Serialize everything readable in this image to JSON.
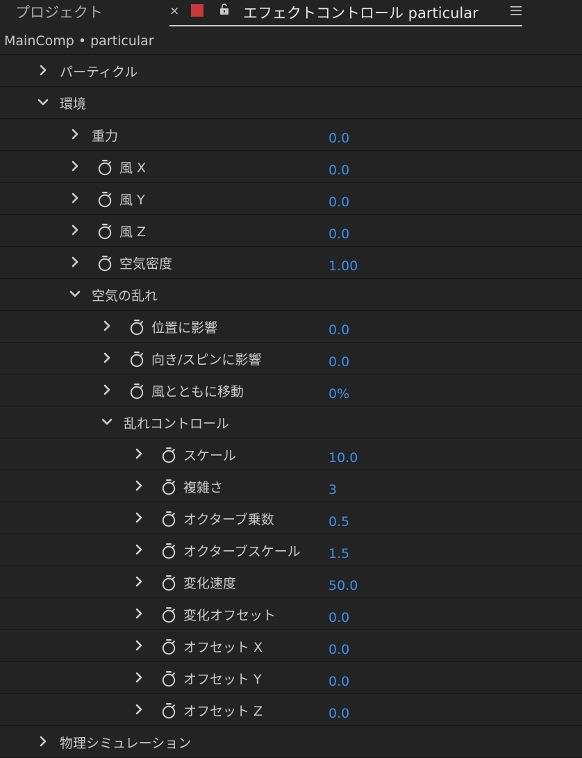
{
  "tabs": {
    "project_label": "プロジェクト",
    "close_glyph": "×",
    "active_label": "エフェクトコントロール particular",
    "accent_color": "#c8373a"
  },
  "breadcrumb": "MainComp • particular",
  "value_color": "#3d8fe8",
  "rows": [
    {
      "label": "パーティクル",
      "value": "",
      "expanded": false,
      "stopwatch": false,
      "depth": 0
    },
    {
      "label": "環境",
      "value": "",
      "expanded": true,
      "stopwatch": false,
      "depth": 0
    },
    {
      "label": "重力",
      "value": "0.0",
      "expanded": false,
      "stopwatch": false,
      "depth": 1
    },
    {
      "label": "風 X",
      "value": "0.0",
      "expanded": false,
      "stopwatch": true,
      "depth": 1
    },
    {
      "label": "風 Y",
      "value": "0.0",
      "expanded": false,
      "stopwatch": true,
      "depth": 1
    },
    {
      "label": "風 Z",
      "value": "0.0",
      "expanded": false,
      "stopwatch": true,
      "depth": 1
    },
    {
      "label": "空気密度",
      "value": "1.00",
      "expanded": false,
      "stopwatch": true,
      "depth": 1
    },
    {
      "label": "空気の乱れ",
      "value": "",
      "expanded": true,
      "stopwatch": false,
      "depth": 1
    },
    {
      "label": "位置に影響",
      "value": "0.0",
      "expanded": false,
      "stopwatch": true,
      "depth": 2
    },
    {
      "label": "向き/スピンに影響",
      "value": "0.0",
      "expanded": false,
      "stopwatch": true,
      "depth": 2
    },
    {
      "label": "風とともに移動",
      "value": "0%",
      "expanded": false,
      "stopwatch": true,
      "depth": 2
    },
    {
      "label": "乱れコントロール",
      "value": "",
      "expanded": true,
      "stopwatch": false,
      "depth": 2
    },
    {
      "label": "スケール",
      "value": "10.0",
      "expanded": false,
      "stopwatch": true,
      "depth": 3
    },
    {
      "label": "複雑さ",
      "value": "3",
      "expanded": false,
      "stopwatch": true,
      "depth": 3
    },
    {
      "label": "オクターブ乗数",
      "value": "0.5",
      "expanded": false,
      "stopwatch": true,
      "depth": 3
    },
    {
      "label": "オクターブスケール",
      "value": "1.5",
      "expanded": false,
      "stopwatch": true,
      "depth": 3
    },
    {
      "label": "変化速度",
      "value": "50.0",
      "expanded": false,
      "stopwatch": true,
      "depth": 3
    },
    {
      "label": "変化オフセット",
      "value": "0.0",
      "expanded": false,
      "stopwatch": true,
      "depth": 3
    },
    {
      "label": "オフセット X",
      "value": "0.0",
      "expanded": false,
      "stopwatch": true,
      "depth": 3
    },
    {
      "label": "オフセット Y",
      "value": "0.0",
      "expanded": false,
      "stopwatch": true,
      "depth": 3
    },
    {
      "label": "オフセット Z",
      "value": "0.0",
      "expanded": false,
      "stopwatch": true,
      "depth": 3
    },
    {
      "label": "物理シミュレーション",
      "value": "",
      "expanded": false,
      "stopwatch": false,
      "depth": 0
    }
  ]
}
